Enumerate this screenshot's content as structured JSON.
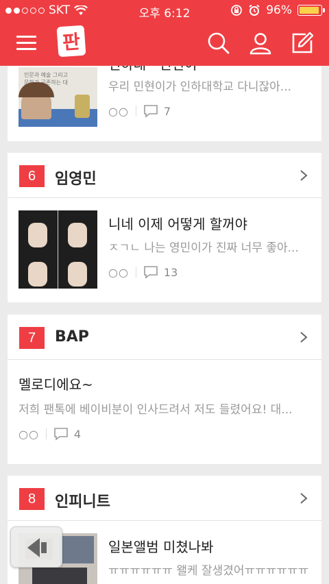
{
  "status_bar": {
    "carrier": "SKT",
    "time": "오후 6:12",
    "battery": "96%",
    "battery_level": 0.96
  },
  "nav": {
    "logo_text": "판",
    "icons": [
      "menu-icon",
      "search-icon",
      "user-icon",
      "compose-icon"
    ]
  },
  "colors": {
    "accent": "#ee3e43"
  },
  "top_partial_post": {
    "title": "인하대 · 민현이",
    "preview": "우리 민현이가 인하대학교 다니잖아...",
    "comments": "7",
    "thumb_caption": "인문과 예술 그리고 문화가 공존하는 대학"
  },
  "categories": [
    {
      "rank": "6",
      "name": "임영민",
      "post": {
        "title": "니네 이제 어떻게 할꺼야",
        "preview": "ㅈㄱㄴ 나는 영민이가 진짜 너무 좋아...",
        "comments": "13"
      }
    },
    {
      "rank": "7",
      "name": "BAP",
      "post": {
        "title": "멜로디에요~",
        "preview": "저희 팬톡에 베이비분이 인사드려서 저도 들렸어요! 대...",
        "comments": "4"
      }
    },
    {
      "rank": "8",
      "name": "인피니트",
      "post": {
        "title": "일본앨범 미쳤나봐",
        "preview": "ㅠㅠㅠㅠㅠㅠ 왤케 잘생겼어ㅠㅠㅠㅠㅠㅠㅠㅠ...",
        "comments": ""
      }
    }
  ],
  "reaction_glyph": "○○"
}
